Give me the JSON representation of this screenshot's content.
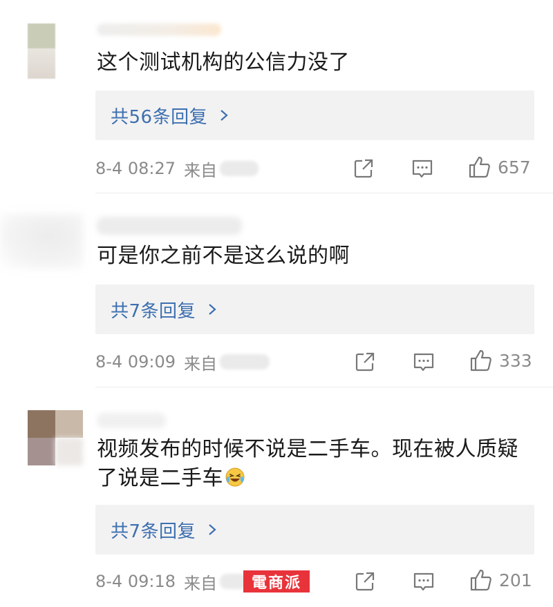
{
  "comments": [
    {
      "text": "这个测试机构的公信力没了",
      "reply_label": "共56条回复",
      "time": "8-4 08:27",
      "source_prefix": "来自",
      "likes": "657"
    },
    {
      "text": "可是你之前不是这么说的啊",
      "reply_label": "共7条回复",
      "time": "8-4 09:09",
      "source_prefix": "来自",
      "likes": "333"
    },
    {
      "text": "视频发布的时候不说是二手车。现在被人质疑了说是二手车",
      "reply_label": "共7条回复",
      "time": "8-4 09:18",
      "source_prefix": "来自",
      "likes": "201"
    }
  ],
  "icons": {
    "share": "share-icon",
    "comment": "comment-icon",
    "like": "thumbs-up-icon",
    "emoji": "laughing-crying-emoji"
  },
  "watermark": "電商派",
  "colors": {
    "link": "#3d6fb0",
    "meta": "#8a8a8a",
    "reply_bg": "#f2f2f2",
    "watermark_bg": "#e8333a"
  }
}
